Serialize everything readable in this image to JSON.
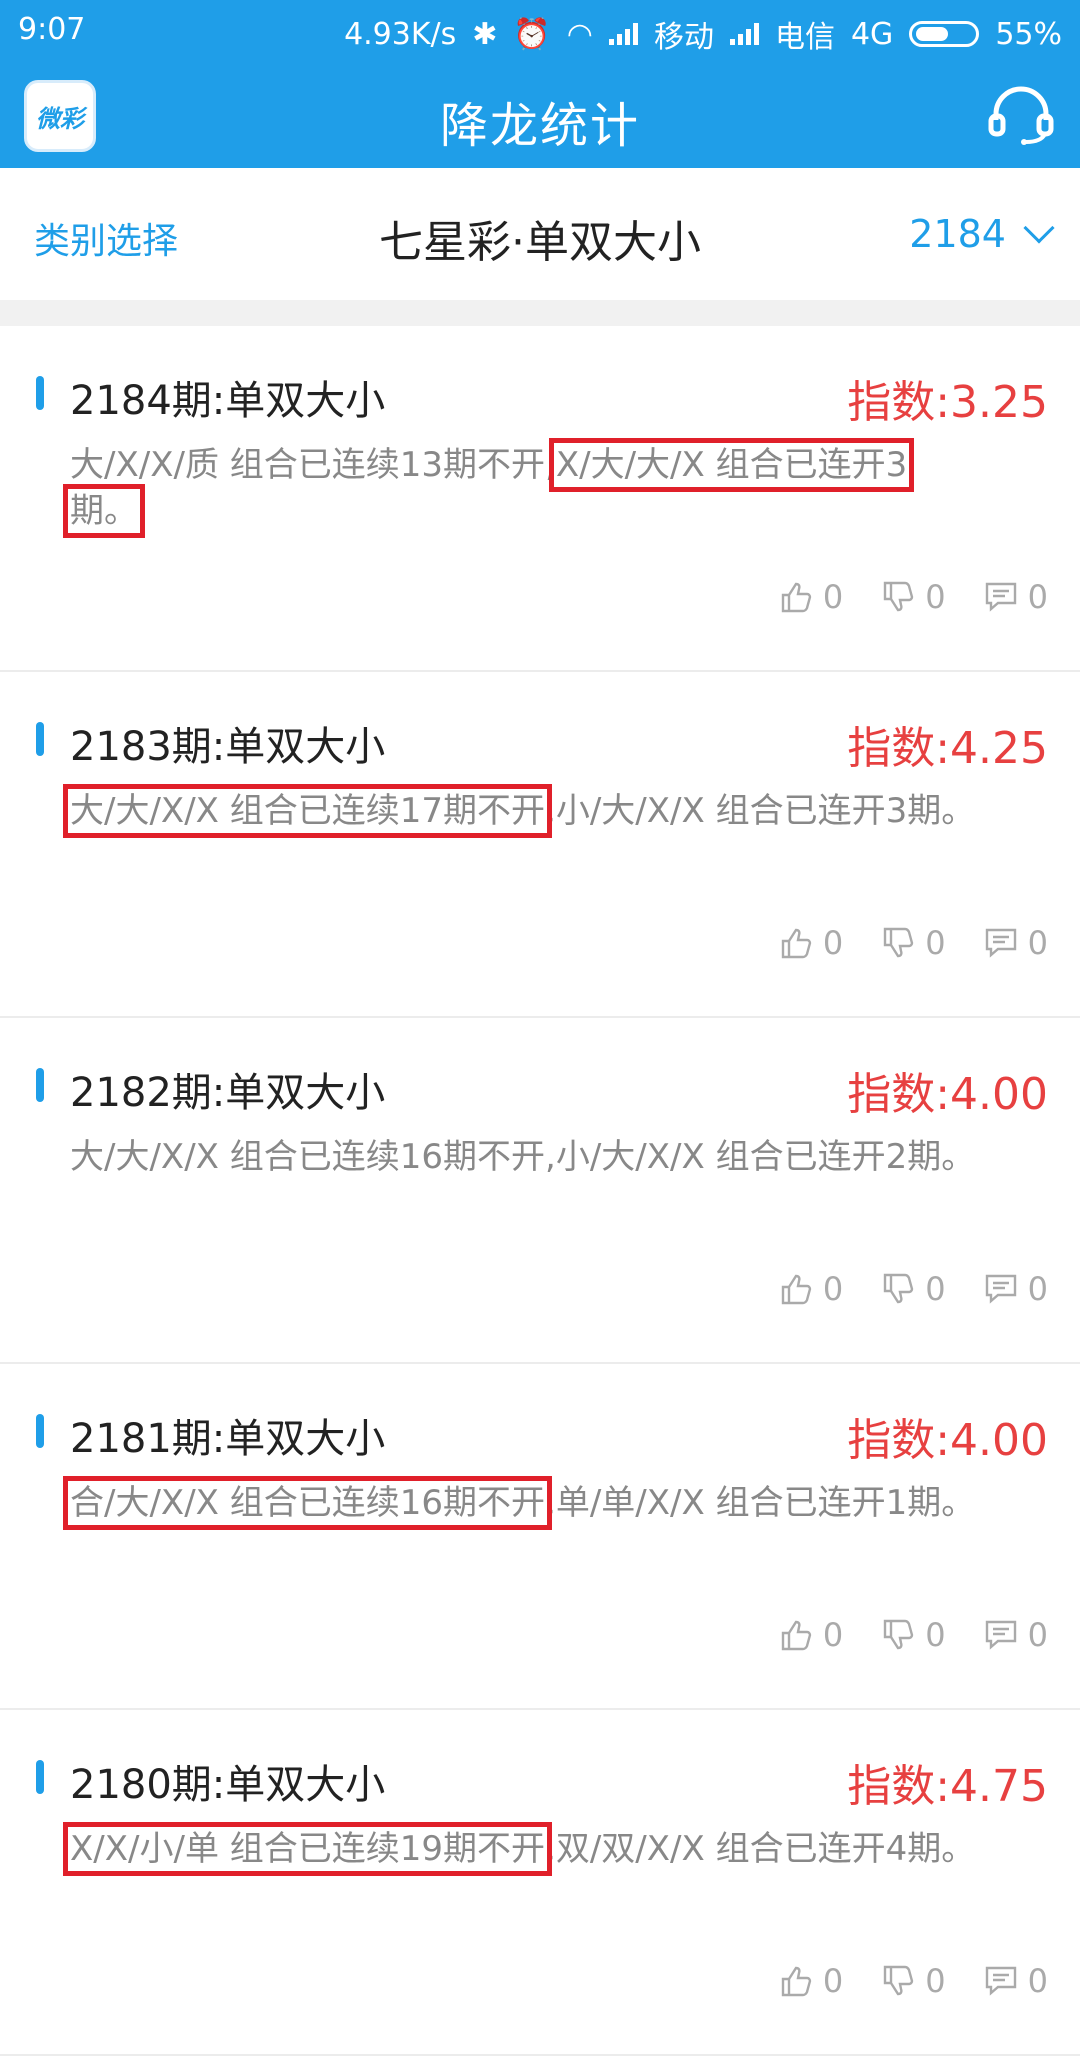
{
  "status_bar": {
    "time": "9:07",
    "speed": "4.93K/s",
    "carrier1": "移动",
    "carrier2": "电信",
    "network": "4G",
    "battery": "55%"
  },
  "header": {
    "logo_text": "微彩",
    "title": "降龙统计"
  },
  "filter": {
    "category_label": "类别选择",
    "title": "七星彩·单双大小",
    "issue": "2184"
  },
  "items": [
    {
      "title": "2184期:单双大小",
      "index": "指数:3.25",
      "desc_a": "大/X/X/质 组合已连续13期不开,",
      "desc_b": "X/大/大/X 组合已连开3",
      "desc_c": "期。",
      "likes": "0",
      "dislikes": "0",
      "comments": "0"
    },
    {
      "title": "2183期:单双大小",
      "index": "指数:4.25",
      "desc_a": "大/大/X/X 组合已连续17期不开",
      "desc_b": ",小/大/X/X 组合已连开3期。",
      "likes": "0",
      "dislikes": "0",
      "comments": "0"
    },
    {
      "title": "2182期:单双大小",
      "index": "指数:4.00",
      "desc_a": "大/大/X/X 组合已连续16期不开,小/大/X/X 组合已连开2期。",
      "likes": "0",
      "dislikes": "0",
      "comments": "0"
    },
    {
      "title": "2181期:单双大小",
      "index": "指数:4.00",
      "desc_a": "合/大/X/X 组合已连续16期不开",
      "desc_b": ",单/单/X/X 组合已连开1期。",
      "likes": "0",
      "dislikes": "0",
      "comments": "0"
    },
    {
      "title": "2180期:单双大小",
      "index": "指数:4.75",
      "desc_a": "X/X/小/单 组合已连续19期不开",
      "desc_b": ",双/双/X/X 组合已连开4期。",
      "likes": "0",
      "dislikes": "0",
      "comments": "0"
    }
  ]
}
